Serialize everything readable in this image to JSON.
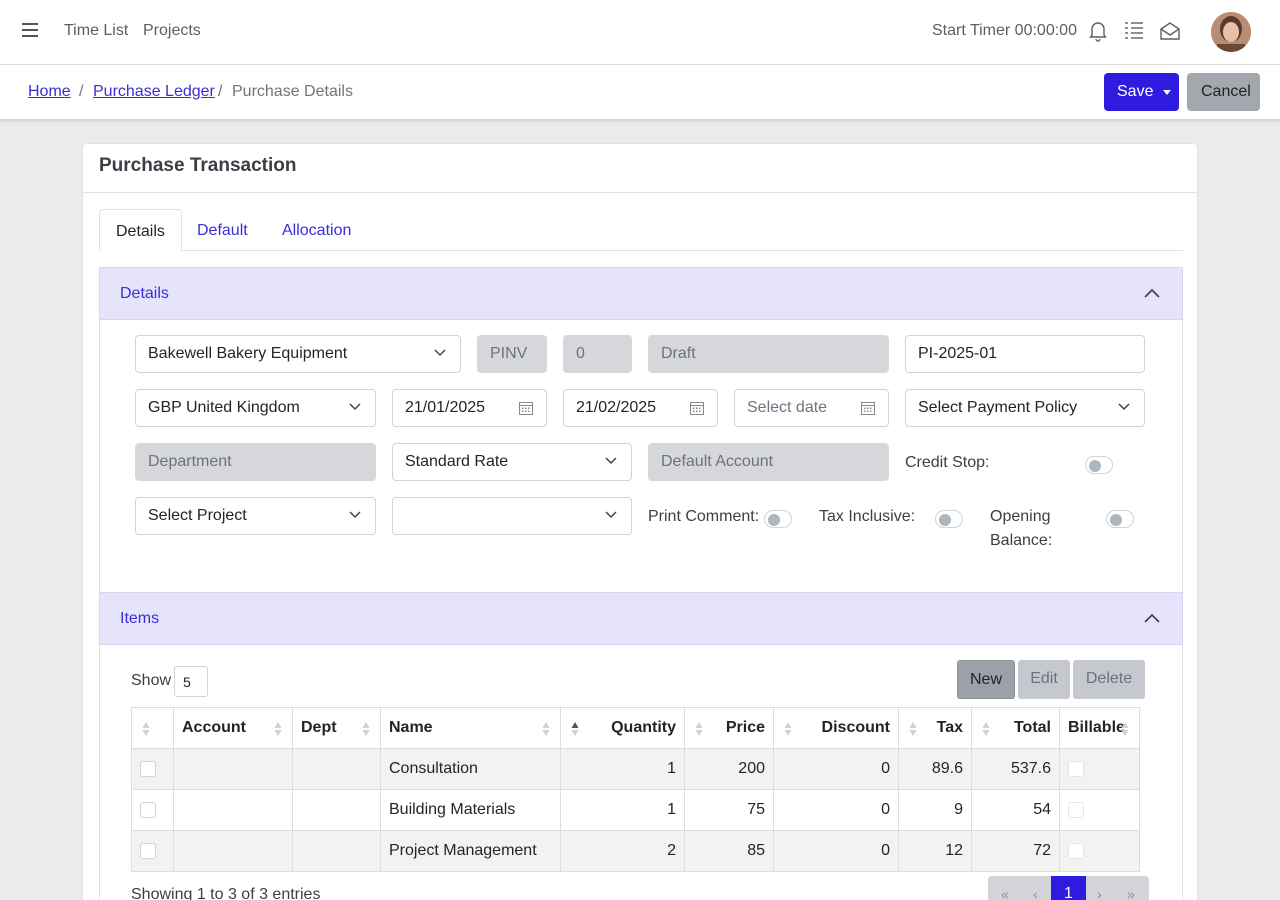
{
  "topbar": {
    "nav": [
      "Time List",
      "Projects"
    ],
    "timer_label": "Start Timer 00:00:00"
  },
  "breadcrumb": {
    "home": "Home",
    "ledger": "Purchase Ledger",
    "current": "Purchase Details",
    "separator": "/"
  },
  "actions": {
    "save": "Save",
    "cancel": "Cancel"
  },
  "card": {
    "title": "Purchase Transaction",
    "tabs": [
      "Details",
      "Default",
      "Allocation"
    ]
  },
  "details": {
    "title": "Details",
    "supplier": "Bakewell Bakery Equipment",
    "type": "PINV",
    "number": "0",
    "status": "Draft",
    "reference": "PI-2025-01",
    "currency": "GBP United Kingdom",
    "date": "21/01/2025",
    "due_date": "21/02/2025",
    "other_date_placeholder": "Select date",
    "payment_policy": "Select Payment Policy",
    "department": "Department",
    "tax_rate": "Standard Rate",
    "default_account": "Default Account",
    "credit_stop": "Credit Stop:",
    "project": "Select Project",
    "print_comment": "Print Comment:",
    "tax_inclusive": "Tax Inclusive:",
    "opening_balance_1": "Opening",
    "opening_balance_2": "Balance:"
  },
  "items": {
    "title": "Items",
    "show_label": "Show",
    "show_value": "5",
    "buttons": {
      "new": "New",
      "edit": "Edit",
      "delete": "Delete"
    },
    "columns": [
      "Account",
      "Dept",
      "Name",
      "Quantity",
      "Price",
      "Discount",
      "Tax",
      "Total",
      "Billable"
    ],
    "rows": [
      {
        "name": "Consultation",
        "quantity": "1",
        "price": "200",
        "discount": "0",
        "tax": "89.6",
        "total": "537.6"
      },
      {
        "name": "Building Materials",
        "quantity": "1",
        "price": "75",
        "discount": "0",
        "tax": "9",
        "total": "54"
      },
      {
        "name": "Project Management",
        "quantity": "2",
        "price": "85",
        "discount": "0",
        "tax": "12",
        "total": "72"
      }
    ],
    "info": "Showing 1 to 3 of 3 entries",
    "pager": {
      "first": "«",
      "prev": "‹",
      "current": "1",
      "next": "›",
      "last": "»"
    }
  }
}
